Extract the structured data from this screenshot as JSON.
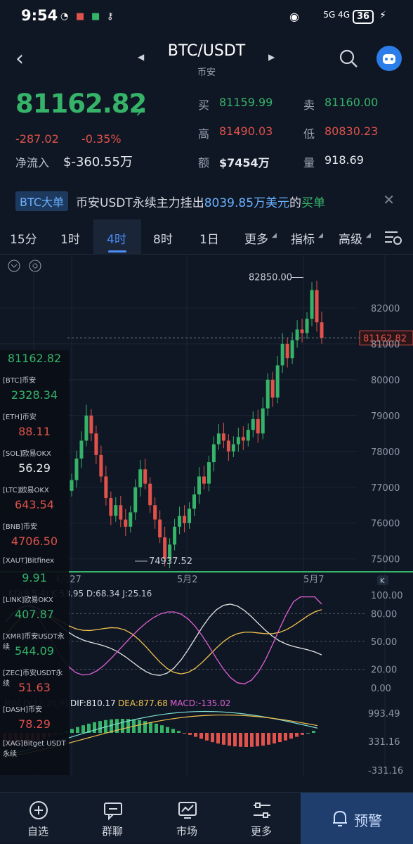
{
  "status_bar": {
    "time": "9:54",
    "network": "5G 4G",
    "battery": "36"
  },
  "header": {
    "pair": "BTC/USDT",
    "exchange": "币安"
  },
  "ticker": {
    "last_price": "81162.82",
    "change": "-287.02",
    "change_pct": "-0.35%",
    "net_inflow_label": "净流入",
    "net_inflow": "$-360.55万",
    "bid_label": "买",
    "bid": "81159.99",
    "ask_label": "卖",
    "ask": "81160.00",
    "high_label": "高",
    "high": "81490.03",
    "low_label": "低",
    "low": "80830.23",
    "amount_label": "额",
    "amount": "$7454万",
    "volume_label": "量",
    "volume": "918.69"
  },
  "banner": {
    "tag": "BTC大单",
    "text_prefix": "币安USDT永续主力挂出",
    "amount": "8039.85万美元",
    "text_mid": "的",
    "action": "买单"
  },
  "tabs": [
    {
      "label": "15分",
      "active": false
    },
    {
      "label": "1时",
      "active": false
    },
    {
      "label": "4时",
      "active": true
    },
    {
      "label": "8时",
      "active": false
    },
    {
      "label": "1日",
      "active": false
    },
    {
      "label": "更多",
      "active": false
    },
    {
      "label": "指标",
      "active": false
    },
    {
      "label": "高级",
      "active": false
    }
  ],
  "chart": {
    "y_ticks": [
      "82000",
      "81000",
      "80000",
      "79000",
      "78000",
      "77000",
      "76000",
      "75000"
    ],
    "current_price_tag": "81162.82",
    "high_marker": "82850.00",
    "low_marker": "74937.52",
    "x_ticks": [
      "4月27",
      "5月2",
      "5月7"
    ],
    "kdj_label": "KD(9,5,4) K:53.95 D:68.34 J:25.16",
    "kdj_ticks": [
      "100.00",
      "80.00",
      "50.00",
      "20.00",
      "0.00"
    ],
    "macd_label_prefix": "MACD(12,26,9)",
    "macd_dif": "DIF:810.17",
    "macd_dea": "DEA:877.68",
    "macd_val": "MACD:-135.02",
    "macd_ticks": [
      "993.49",
      "331.16",
      "-331.16"
    ]
  },
  "chart_data": {
    "type": "candlestick",
    "x_labels": [
      "4月27",
      "5月2",
      "5月7"
    ],
    "ylim": [
      74700,
      82900
    ],
    "close_series": [
      77200,
      77800,
      78300,
      79000,
      78500,
      77900,
      77300,
      76700,
      76200,
      76500,
      76100,
      75900,
      76300,
      77000,
      77500,
      77100,
      76500,
      76100,
      75600,
      75000,
      75400,
      75900,
      76200,
      76000,
      76400,
      76800,
      77300,
      77100,
      77700,
      78200,
      78500,
      78300,
      78000,
      78200,
      78400,
      78300,
      78600,
      78900,
      78500,
      79200,
      80000,
      79500,
      80400,
      81000,
      80600,
      81100,
      81400,
      81300,
      81700,
      82500,
      81600,
      81162
    ]
  },
  "watchlist": [
    {
      "price": "81162.82",
      "name": "[BTC]币安",
      "color": "#35b369"
    },
    {
      "price": "2328.34",
      "name": "[ETH]币安",
      "color": "#35b369"
    },
    {
      "price": "88.11",
      "name": "[SOL]欧易OKX",
      "color": "#e0524b"
    },
    {
      "price": "56.29",
      "name": "[LTC]欧易OKX",
      "color": "#e6e9ef"
    },
    {
      "price": "643.54",
      "name": "[BNB]币安",
      "color": "#e0524b"
    },
    {
      "price": "4706.50",
      "name": "[XAUT]Bitfinex",
      "color": "#e0524b"
    },
    {
      "price": "9.91",
      "name": "[LINK]欧易OKX",
      "color": "#35b369"
    },
    {
      "price": "407.87",
      "name": "[XMR]币安USDT永续",
      "color": "#35b369"
    },
    {
      "price": "544.09",
      "name": "[ZEC]币安USDT永续",
      "color": "#35b369"
    },
    {
      "price": "51.63",
      "name": "[DASH]币安",
      "color": "#e0524b"
    },
    {
      "price": "78.29",
      "name": "[XAG]Bitget USDT永续",
      "color": "#e0524b"
    }
  ],
  "bottom_nav": [
    {
      "label": "自选",
      "icon": "plus-circle-icon"
    },
    {
      "label": "群聊",
      "icon": "chat-icon"
    },
    {
      "label": "市场",
      "icon": "market-chart-icon"
    },
    {
      "label": "更多",
      "icon": "more-sliders-icon"
    }
  ],
  "alert_button": "预警"
}
